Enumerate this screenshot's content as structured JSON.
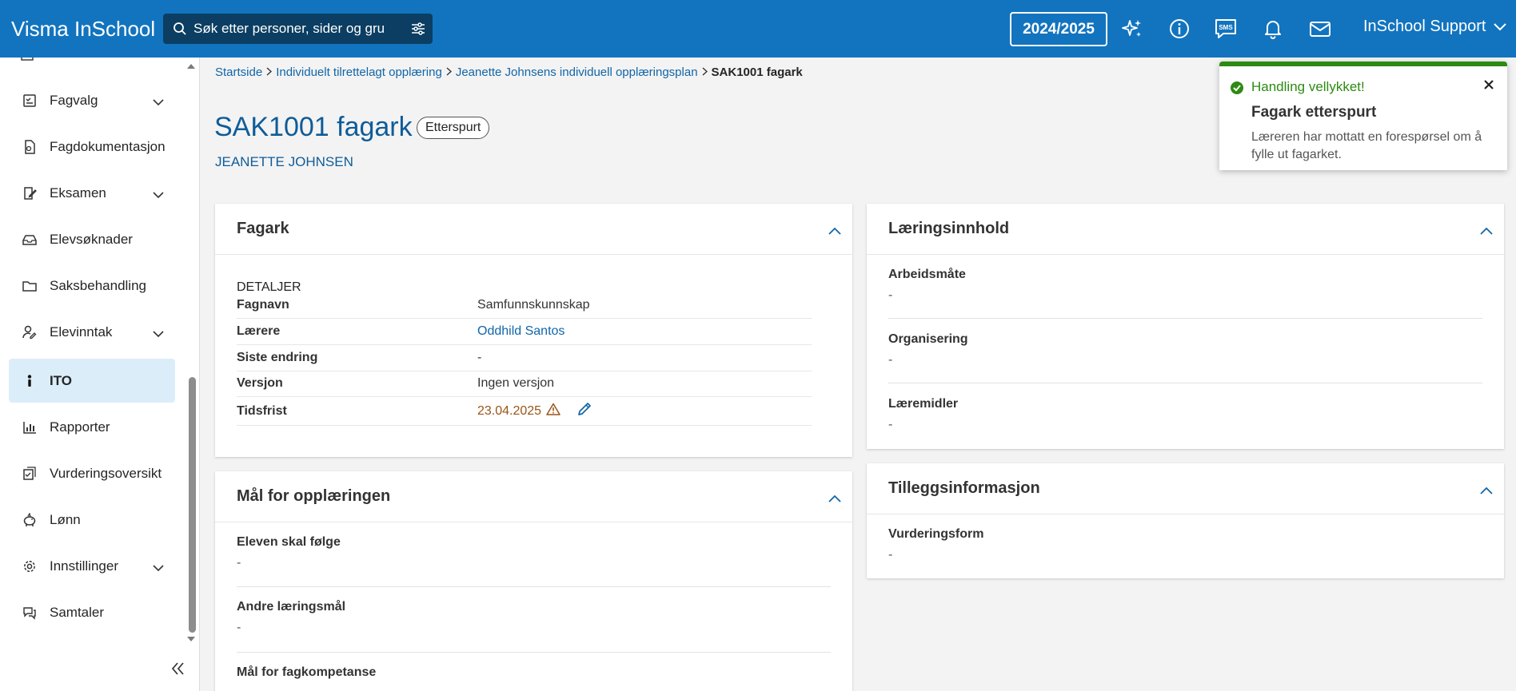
{
  "app": {
    "title": "Visma InSchool"
  },
  "search": {
    "placeholder": "Søk etter personer, sider og grupper"
  },
  "header": {
    "school_year": "2024/2025",
    "user_name": "InSchool Support"
  },
  "sidebar": {
    "items": [
      {
        "label": "Fagvalg",
        "icon": "checklist-icon",
        "expandable": true
      },
      {
        "label": "Fagdokumentasjon",
        "icon": "document-icon",
        "expandable": false
      },
      {
        "label": "Eksamen",
        "icon": "exam-edit-icon",
        "expandable": true
      },
      {
        "label": "Elevsøknader",
        "icon": "inbox-icon",
        "expandable": false
      },
      {
        "label": "Saksbehandling",
        "icon": "folder-icon",
        "expandable": false
      },
      {
        "label": "Elevinntak",
        "icon": "user-edit-icon",
        "expandable": true
      },
      {
        "label": "ITO",
        "icon": "person-icon",
        "expandable": false,
        "active": true
      },
      {
        "label": "Rapporter",
        "icon": "bar-chart-icon",
        "expandable": false
      },
      {
        "label": "Vurderingsoversikt",
        "icon": "assessment-icon",
        "expandable": false
      },
      {
        "label": "Lønn",
        "icon": "piggy-bank-icon",
        "expandable": false
      },
      {
        "label": "Innstillinger",
        "icon": "gear-icon",
        "expandable": true
      },
      {
        "label": "Samtaler",
        "icon": "chat-icon",
        "expandable": false
      }
    ]
  },
  "breadcrumb": {
    "items": [
      "Startside",
      "Individuelt tilrettelagt opplæring",
      "Jeanette Johnsens individuell opplæringsplan"
    ],
    "current": "SAK1001 fagark"
  },
  "page": {
    "title": "SAK1001 fagark",
    "status": "Etterspurt",
    "student": "JEANETTE JOHNSEN"
  },
  "fagark": {
    "heading": "Fagark",
    "section_label": "DETALJER",
    "rows": [
      {
        "key": "Fagnavn",
        "value": "Samfunnskunnskap"
      },
      {
        "key": "Lærere",
        "value": "Oddhild Santos"
      },
      {
        "key": "Siste endring",
        "value": "-"
      },
      {
        "key": "Versjon",
        "value": "Ingen versjon"
      },
      {
        "key": "Tidsfrist",
        "value": "23.04.2025"
      }
    ]
  },
  "maal": {
    "heading": "Mål for opplæringen",
    "fields": [
      {
        "label": "Eleven skal følge",
        "value": "-"
      },
      {
        "label": "Andre læringsmål",
        "value": "-"
      },
      {
        "label": "Mål for fagkompetanse",
        "value": ""
      }
    ]
  },
  "laeringsinnhold": {
    "heading": "Læringsinnhold",
    "fields": [
      {
        "label": "Arbeidsmåte",
        "value": "-"
      },
      {
        "label": "Organisering",
        "value": "-"
      },
      {
        "label": "Læremidler",
        "value": "-"
      }
    ]
  },
  "tillegg": {
    "heading": "Tilleggsinformasjon",
    "fields": [
      {
        "label": "Vurderingsform",
        "value": "-"
      }
    ]
  },
  "toast": {
    "status": "Handling vellykket!",
    "title": "Fagark etterspurt",
    "message": "Læreren har mottatt en forespørsel om å fylle ut fagarket."
  },
  "colors": {
    "topbar": "#1274bf",
    "primary_text": "#0f5c98",
    "link": "#1166a8",
    "success": "#2d8a12",
    "warning": "#9b5418",
    "active_nav": "#dcedfa"
  }
}
